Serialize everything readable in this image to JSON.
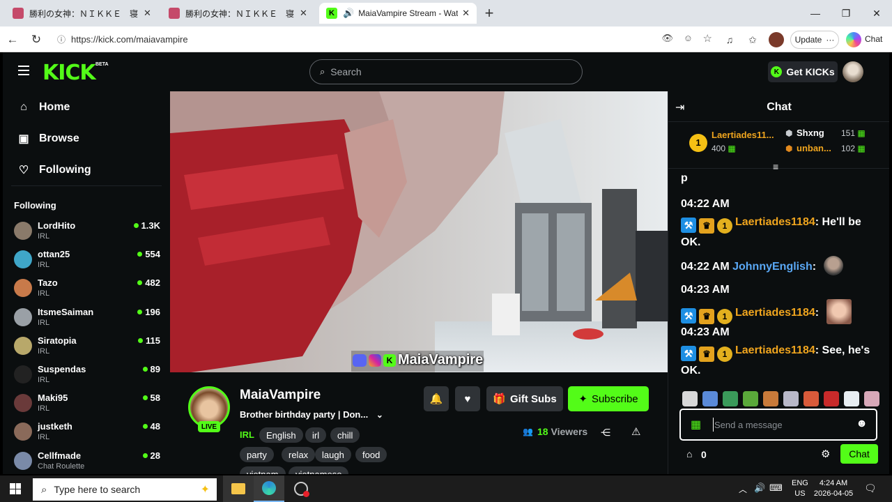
{
  "browser": {
    "tabs": [
      {
        "title": "勝利の女神：ＮＩＫＫＥ　寝ころび",
        "active": false
      },
      {
        "title": "勝利の女神：ＮＩＫＫＥ　寝ころび",
        "active": false
      },
      {
        "title": "MaiaVampire Stream - Watch",
        "active": true
      }
    ],
    "new_tab": "+",
    "url": "https://kick.com/maiavampire",
    "update_label": "Update",
    "chat_label": "Chat"
  },
  "kick": {
    "logo": "KICK",
    "beta": "BETA",
    "search_placeholder": "Search",
    "get_kicks": "Get KICKs",
    "nav": {
      "home": "Home",
      "browse": "Browse",
      "following": "Following"
    },
    "following_heading": "Following",
    "following": [
      {
        "name": "LordHito",
        "category": "IRL",
        "viewers": "1.3K",
        "color": "#8a7a6a"
      },
      {
        "name": "ottan25",
        "category": "IRL",
        "viewers": "554",
        "color": "#3fa6c8"
      },
      {
        "name": "Tazo",
        "category": "IRL",
        "viewers": "482",
        "color": "#c87a4a"
      },
      {
        "name": "ItsmeSaiman",
        "category": "IRL",
        "viewers": "196",
        "color": "#9aa0a6"
      },
      {
        "name": "Siratopia",
        "category": "IRL",
        "viewers": "115",
        "color": "#b8a86a"
      },
      {
        "name": "Suspendas",
        "category": "IRL",
        "viewers": "89",
        "color": "#222"
      },
      {
        "name": "Maki95",
        "category": "IRL",
        "viewers": "58",
        "color": "#6a3a3a"
      },
      {
        "name": "justketh",
        "category": "IRL",
        "viewers": "48",
        "color": "#8a6a5a"
      },
      {
        "name": "Cellfmade",
        "category": "Chat Roulette",
        "viewers": "28",
        "color": "#7a8aa8"
      }
    ],
    "overlay_name": "MaiaVampire",
    "channel": {
      "name": "MaiaVampire",
      "live": "LIVE",
      "title": "Brother birthday party | Don...",
      "category": "IRL",
      "tags_row1": [
        "English",
        "irl",
        "chill"
      ],
      "tags_row2": [
        "party",
        "relax",
        "laugh",
        "food"
      ],
      "tags_row3": [
        "vietnam",
        "vietnamese"
      ],
      "gift_subs": "Gift Subs",
      "subscribe": "Subscribe",
      "viewers_count": "18",
      "viewers_label": "Viewers"
    },
    "chat": {
      "title": "Chat",
      "leaderboard": {
        "first": {
          "rank": "1",
          "name": "Laertiades11...",
          "amount": "400"
        },
        "second": {
          "name": "Shxng",
          "amount": "151"
        },
        "third": {
          "name": "unban...",
          "amount": "102"
        }
      },
      "partial_line": "p",
      "messages": [
        {
          "time": "04:22 AM",
          "user": "Laertiades1184",
          "text": ": He'll be OK."
        },
        {
          "time": "04:22 AM",
          "user": "JohnnyEnglish",
          "text": ":"
        },
        {
          "time": "04:23 AM",
          "user": "Laertiades1184",
          "text": ":"
        },
        {
          "time": "04:23 AM",
          "user": "Laertiades1184",
          "text": ": See, he's OK."
        }
      ],
      "input_placeholder": "Send a message",
      "kicks_count": "0",
      "send_label": "Chat"
    }
  },
  "taskbar": {
    "search_placeholder": "Type here to search",
    "lang": "ENG",
    "region": "US",
    "time": "4:24 AM",
    "date": "2026-04-05"
  },
  "colors": {
    "kick_green": "#53fc18",
    "bg": "#0b0e0f",
    "username_orange": "#f0a51e",
    "username_blue": "#5aa8f5"
  }
}
